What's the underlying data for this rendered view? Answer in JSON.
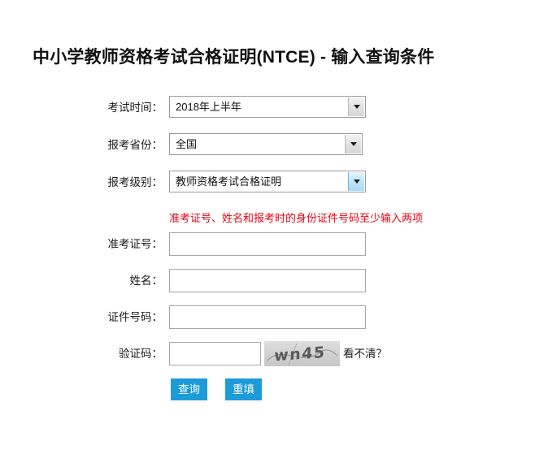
{
  "page": {
    "title": "中小学教师资格考试合格证明(NTCE) - 输入查询条件"
  },
  "form": {
    "exam_time": {
      "label": "考试时间：",
      "value": "2018年上半年"
    },
    "province": {
      "label": "报考省份：",
      "value": "全国"
    },
    "level": {
      "label": "报考级别：",
      "value": "教师资格考试合格证明"
    },
    "hint": "准考证号、姓名和报考时的身份证件号码至少输入两项",
    "admission_ticket": {
      "label": "准考证号：",
      "value": "",
      "placeholder": ""
    },
    "name": {
      "label": "姓名：",
      "value": "",
      "placeholder": ""
    },
    "id_number": {
      "label": "证件号码：",
      "value": "",
      "placeholder": ""
    },
    "captcha": {
      "label": "验证码：",
      "value": "",
      "placeholder": "",
      "image_text": "wn45",
      "refresh_label": "看不清？"
    }
  },
  "buttons": {
    "query": "查询",
    "reset": "重填"
  },
  "colors": {
    "button_blue": "#1d9bd9",
    "hint_red": "#e60012",
    "select_border": "#9a9a9a",
    "input_border": "#a6a6a6",
    "captcha_bg": "#d2d2d2"
  },
  "icons": {
    "dropdown_caret": "chevron-down-icon"
  }
}
